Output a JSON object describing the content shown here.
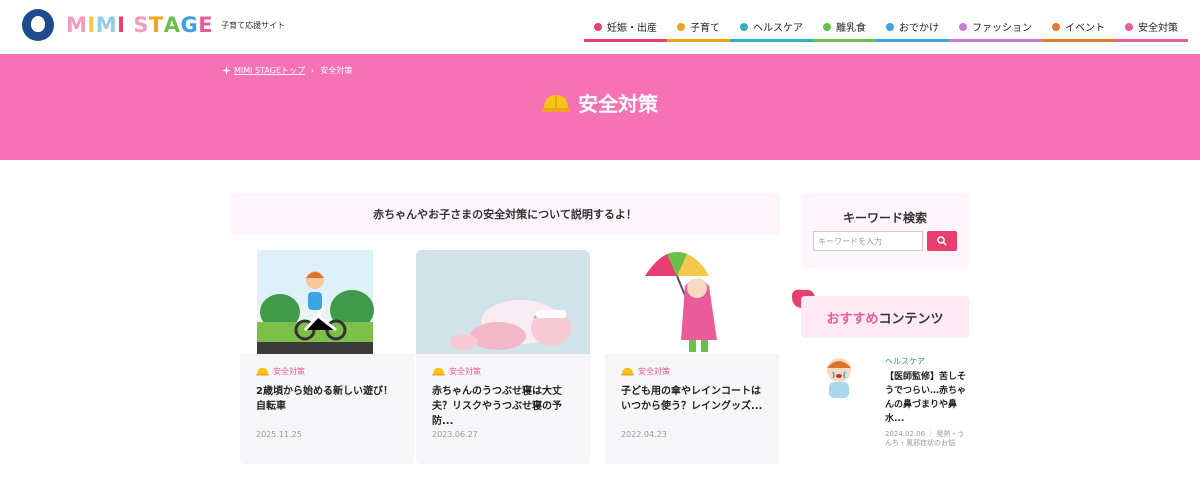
{
  "header": {
    "logo_text": "MIMI STAGE",
    "logo_sub": "子育て応援サイト",
    "nav": [
      {
        "label": "妊娠・出産",
        "color": "#e83f6f"
      },
      {
        "label": "子育て",
        "color": "#f2a31b"
      },
      {
        "label": "ヘルスケア",
        "color": "#2bb3c0"
      },
      {
        "label": "離乳食",
        "color": "#69c04a"
      },
      {
        "label": "おでかけ",
        "color": "#3ba3e0"
      },
      {
        "label": "ファッション",
        "color": "#c77ad9"
      },
      {
        "label": "イベント",
        "color": "#e07a2e"
      },
      {
        "label": "安全対策",
        "color": "#e85c9c"
      }
    ]
  },
  "breadcrumb": {
    "home": "MIMI STAGEトップ",
    "sep": "›",
    "current": "安全対策"
  },
  "hero": {
    "title": "安全対策"
  },
  "intro": "赤ちゃんやお子さまの安全対策について説明するよ！",
  "cards": [
    {
      "category": "安全対策",
      "title": "2歳頃から始める新しい遊び！自転車",
      "date": "2025.11.25"
    },
    {
      "category": "安全対策",
      "title": "赤ちゃんのうつぶせ寝は大丈夫？リスクやうつぶせ寝の予防...",
      "date": "2023.06.27"
    },
    {
      "category": "安全対策",
      "title": "子ども用の傘やレインコートはいつから使う？レイングッズ...",
      "date": "2022.04.23"
    }
  ],
  "sidebar": {
    "search_title": "キーワード検索",
    "search_placeholder": "キーワードを入力",
    "rec_title_pink": "おすすめ",
    "rec_title_rest": "コンテンツ",
    "rec_item": {
      "category": "ヘルスケア",
      "title": "【医師監修】苦しそうでつらい…赤ちゃんの鼻づまりや鼻水...",
      "meta": "2024.02.06 ｜ 発熱・うんち・風邪症状のお悩"
    }
  },
  "colors": {
    "hero_pink": "#f772b5",
    "accent_red": "#e83f6f",
    "category_pink": "#e85c9c",
    "category_green": "#2b9f6b"
  }
}
